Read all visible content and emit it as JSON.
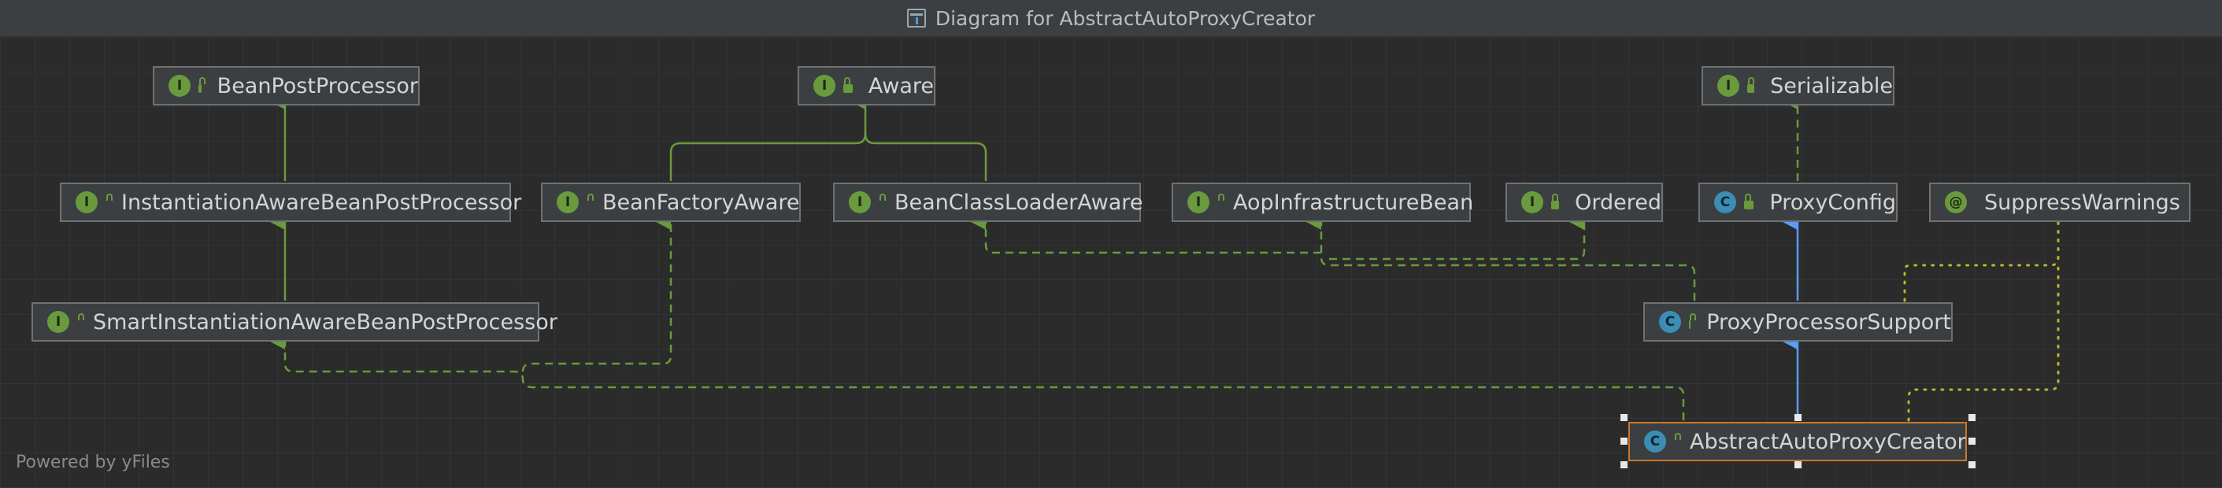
{
  "window": {
    "title": "Diagram for AbstractAutoProxyCreator"
  },
  "colors": {
    "interface_badge": "#6a9a3e",
    "class_badge": "#3c8db3",
    "implements_edge": "#6a9a3e",
    "extends_edge": "#589df6",
    "annotation_edge": "#bbb529",
    "selection": "#c9762a"
  },
  "nodes": {
    "bean_post_processor": {
      "label": "BeanPostProcessor",
      "kind": "I",
      "icon": "interface-icon"
    },
    "aware": {
      "label": "Aware",
      "kind": "I",
      "icon": "interface-icon"
    },
    "serializable": {
      "label": "Serializable",
      "kind": "I",
      "icon": "interface-icon"
    },
    "instantiation_aware": {
      "label": "InstantiationAwareBeanPostProcessor",
      "kind": "I",
      "icon": "interface-icon"
    },
    "bean_factory_aware": {
      "label": "BeanFactoryAware",
      "kind": "I",
      "icon": "interface-icon"
    },
    "bean_class_loader_aware": {
      "label": "BeanClassLoaderAware",
      "kind": "I",
      "icon": "interface-icon"
    },
    "aop_infrastructure_bean": {
      "label": "AopInfrastructureBean",
      "kind": "I",
      "icon": "interface-icon"
    },
    "ordered": {
      "label": "Ordered",
      "kind": "I",
      "icon": "interface-icon"
    },
    "proxy_config": {
      "label": "ProxyConfig",
      "kind": "C",
      "icon": "class-icon"
    },
    "suppress_warnings": {
      "label": "SuppressWarnings",
      "kind": "@",
      "icon": "annotation-icon"
    },
    "smart_instantiation_aware": {
      "label": "SmartInstantiationAwareBeanPostProcessor",
      "kind": "I",
      "icon": "interface-icon"
    },
    "proxy_processor_support": {
      "label": "ProxyProcessorSupport",
      "kind": "C",
      "icon": "class-icon"
    },
    "abstract_auto_proxy_creator": {
      "label": "AbstractAutoProxyCreator",
      "kind": "C",
      "icon": "class-icon"
    }
  },
  "footer": {
    "text": "Powered by yFiles"
  }
}
